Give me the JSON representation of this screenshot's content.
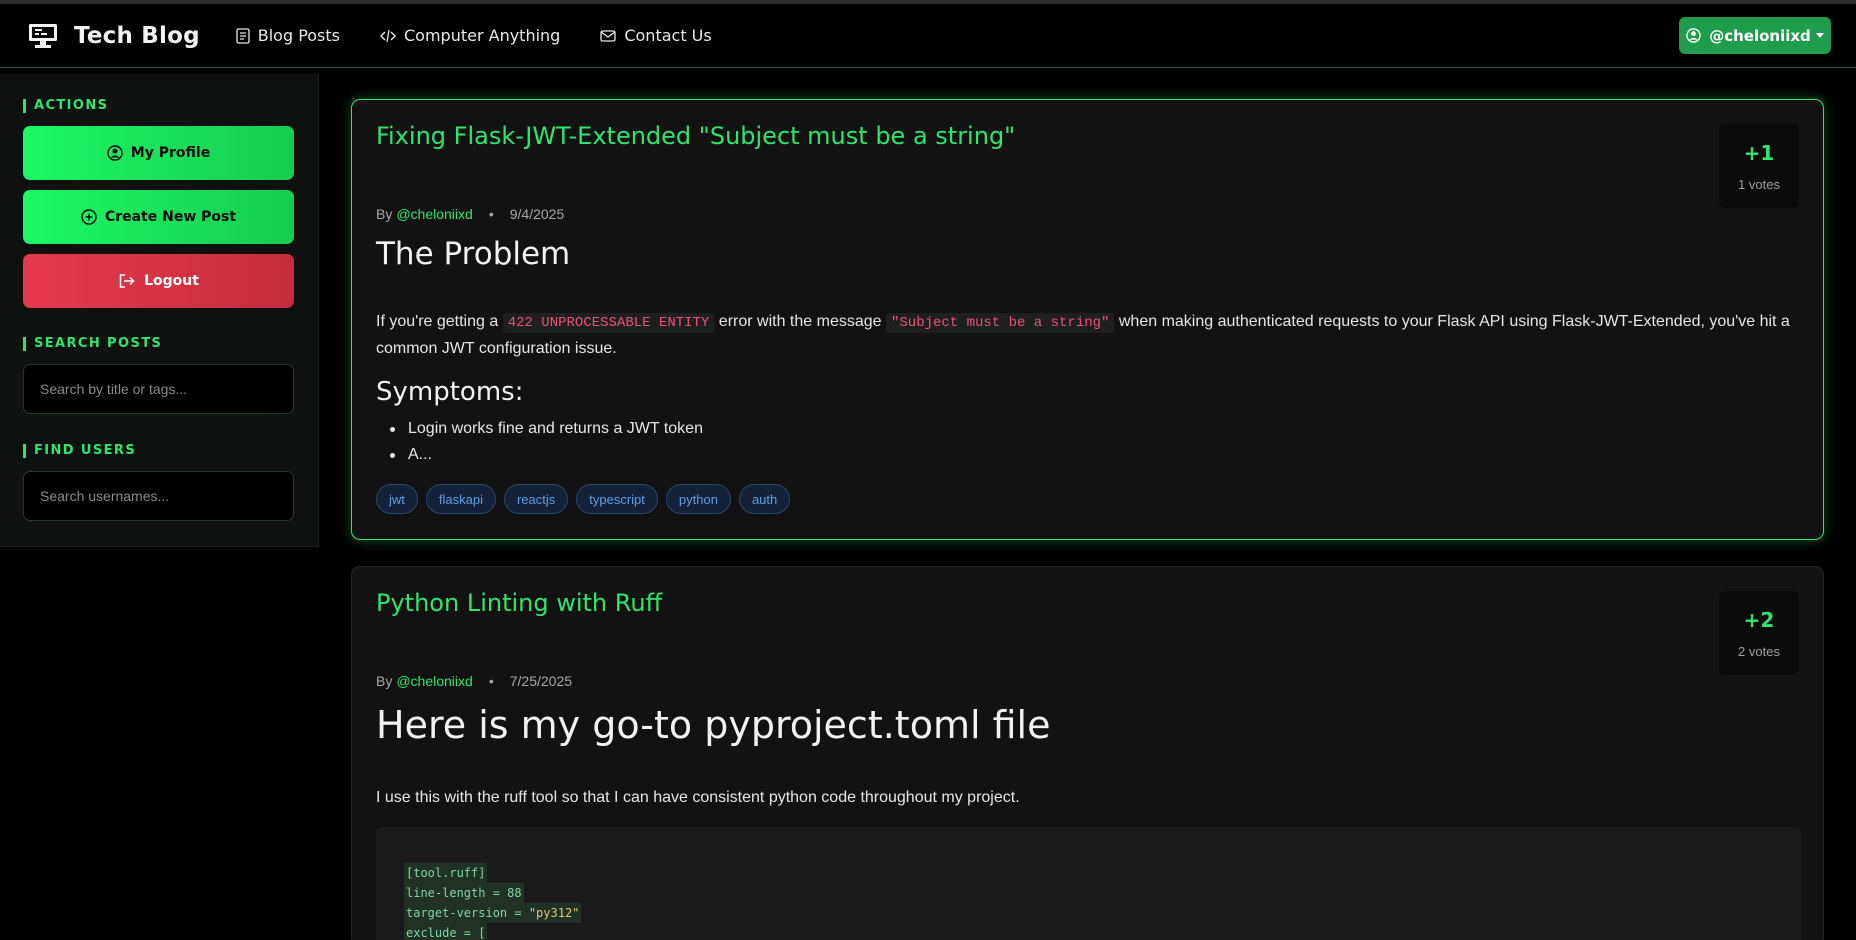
{
  "brand": {
    "title": "Tech Blog"
  },
  "nav": {
    "links": [
      "Blog Posts",
      "Computer Anything",
      "Contact Us"
    ],
    "user": "@cheloniixd"
  },
  "sidebar": {
    "actions_heading": "ACTIONS",
    "buttons": [
      "My Profile",
      "Create New Post",
      "Logout"
    ],
    "search_heading": "SEARCH POSTS",
    "search_placeholder": "Search by title or tags...",
    "users_heading": "FIND USERS",
    "users_placeholder": "Search usernames..."
  },
  "posts": [
    {
      "title": "Fixing Flask-JWT-Extended \"Subject must be a string\"",
      "score": "+1",
      "votes": "1 votes",
      "by": "By",
      "author": "@cheloniixd",
      "date": "9/4/2025",
      "heading": "The Problem",
      "para_a": "If you're getting a",
      "code_a": "422 UNPROCESSABLE ENTITY",
      "para_b": "error with the message",
      "code_b": "\"Subject must be a string\"",
      "para_c": "when making authenticated requests to your Flask API using Flask-JWT-Extended, you've hit a common JWT configuration issue.",
      "subheading": "Symptoms:",
      "bullets": [
        "Login works fine and returns a JWT token",
        "A..."
      ],
      "tags": [
        "jwt",
        "flaskapi",
        "reactjs",
        "typescript",
        "python",
        "auth"
      ]
    },
    {
      "title": "Python Linting with Ruff",
      "score": "+2",
      "votes": "2 votes",
      "by": "By",
      "author": "@cheloniixd",
      "date": "7/25/2025",
      "heading": "Here is my go-to pyproject.toml file",
      "para": "I use this with the ruff tool so that I can have consistent python code throughout my project.",
      "code": {
        "line1": "[tool.ruff]",
        "line2": "line-length = 88",
        "line3_key": "target-version = ",
        "line3_val": "\"py312\"",
        "line4": "exclude = ["
      }
    }
  ],
  "colors": {
    "accent": "#2ee66b",
    "danger": "#e33a4c",
    "tag": "#5aa0e6"
  }
}
